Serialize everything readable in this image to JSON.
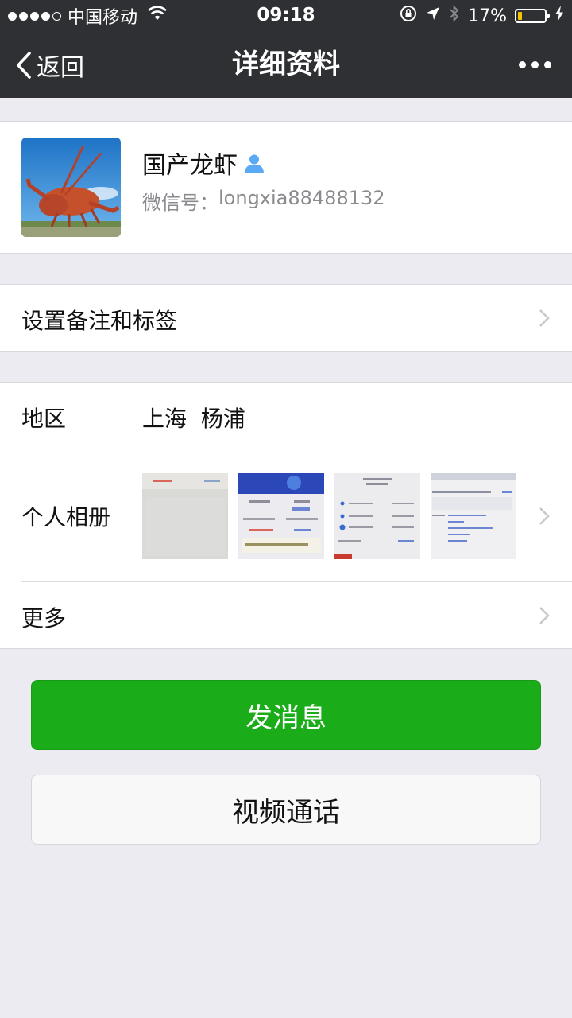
{
  "status_bar": {
    "carrier": "中国移动",
    "time": "09:18",
    "battery_percent": "17%",
    "battery_level": 0.17,
    "signal_bars_filled": 4
  },
  "nav": {
    "back_label": "返回",
    "title": "详细资料"
  },
  "profile": {
    "name": "国产龙虾",
    "wechat_id_label": "微信号：",
    "wechat_id": "longxia88488132"
  },
  "remark_row": {
    "label": "设置备注和标签"
  },
  "region": {
    "label": "地区",
    "value": "上海  杨浦"
  },
  "album": {
    "label": "个人相册"
  },
  "more_row": {
    "label": "更多"
  },
  "buttons": {
    "send_message": "发消息",
    "video_call": "视频通话"
  },
  "colors": {
    "nav_bg": "#2f3033",
    "page_bg": "#ebebf1",
    "primary_green": "#1aad19",
    "contact_icon_blue": "#59a9f4"
  }
}
